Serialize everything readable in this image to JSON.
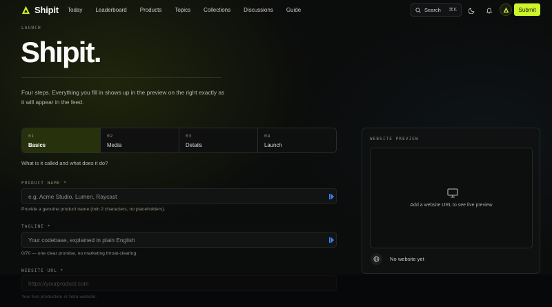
{
  "nav": {
    "brand": "Shipit",
    "links": [
      "Today",
      "Leaderboard",
      "Products",
      "Topics",
      "Collections",
      "Discussions",
      "Guide"
    ],
    "search_label": "Search",
    "search_shortcut": "⌘K",
    "submit_label": "Submit",
    "accent_color": "#cdf52a"
  },
  "hero": {
    "eyebrow": "LAUNCH",
    "title": "Shipit.",
    "description": "Four steps. Everything you fill in shows up in the preview on the right exactly as it will appear in the feed."
  },
  "steps": [
    {
      "num": "01",
      "label": "Basics",
      "active": true
    },
    {
      "num": "02",
      "label": "Media",
      "active": false
    },
    {
      "num": "03",
      "label": "Details",
      "active": false
    },
    {
      "num": "04",
      "label": "Launch",
      "active": false
    }
  ],
  "form": {
    "prompt": "What is it called and what does it do?",
    "product_name": {
      "label": "PRODUCT NAME *",
      "placeholder": "e.g. Acme Studio, Lumen, Raycast",
      "hint": "Provide a genuine product name (min 2 characters, no placeholders)."
    },
    "tagline": {
      "label": "TAGLINE *",
      "placeholder": "Your codebase, explained in plain English",
      "hint": "0/70 — one clear promise, no marketing throat-clearing."
    },
    "website_url": {
      "label": "WEBSITE URL *",
      "placeholder": "https://yourproduct.com",
      "hint": "Your live production or beta website."
    }
  },
  "preview": {
    "title": "WEBSITE PREVIEW",
    "empty_text": "Add a website URL to see live preview",
    "status": "No website yet"
  }
}
